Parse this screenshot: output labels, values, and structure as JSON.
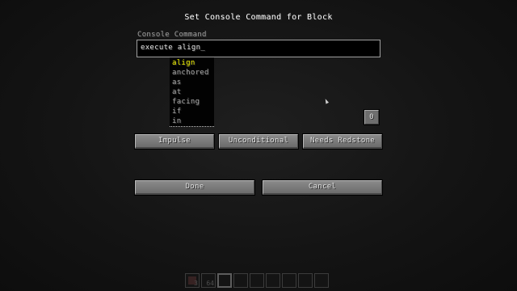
{
  "screen": {
    "title": "Set Console Command for Block"
  },
  "command": {
    "label": "Console Command",
    "value": "execute align_"
  },
  "suggestions": {
    "selected_index": 0,
    "items": [
      "align",
      "anchored",
      "as",
      "at",
      "facing",
      "if",
      "in"
    ]
  },
  "success_count": "0",
  "mode_buttons": {
    "impulse": "Impulse",
    "unconditional": "Unconditional",
    "needs_redstone": "Needs Redstone"
  },
  "actions": {
    "done": "Done",
    "cancel": "Cancel"
  },
  "hotbar": {
    "slot1_qty": "3",
    "slot2_qty": "64"
  },
  "colors": {
    "selected_suggestion": "#fcfc00",
    "label": "#a0a0a0",
    "button_face": "#6c6c6c"
  }
}
